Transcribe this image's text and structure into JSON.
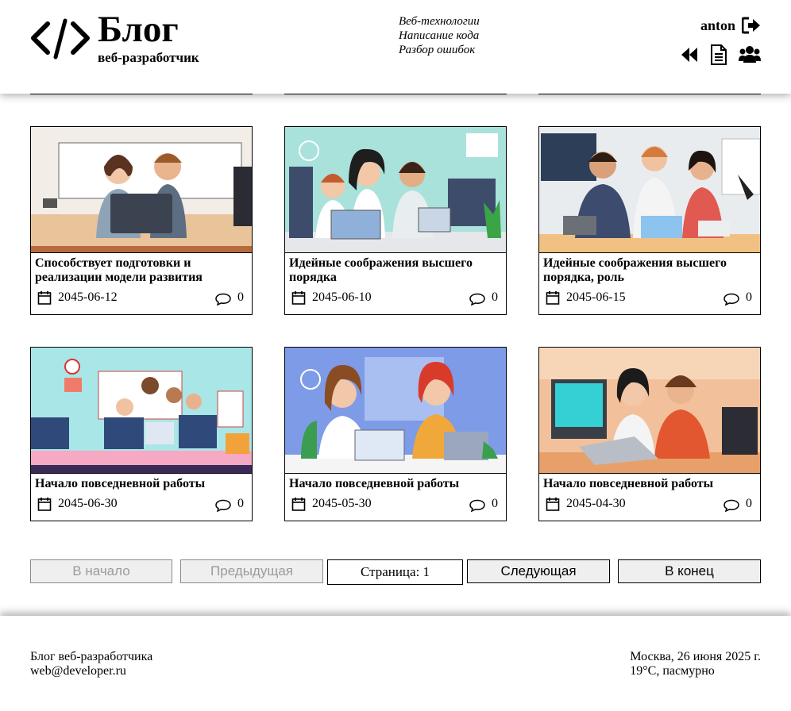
{
  "header": {
    "logo_title": "Блог",
    "logo_subtitle": "веб-разработчик",
    "topics": [
      "Веб-технологии",
      "Написание кода",
      "Разбор ошибок"
    ],
    "username": "anton",
    "icons": [
      "logout-icon",
      "backward-icon",
      "document-icon",
      "users-icon"
    ]
  },
  "posts": [
    {
      "title": "Способствует подготовки и реализации модели развития",
      "date": "2045-06-12",
      "comments": "0"
    },
    {
      "title": "Идейные соображения высшего порядка",
      "date": "2045-06-10",
      "comments": "0"
    },
    {
      "title": "Идейные соображения высшего порядка, роль",
      "date": "2045-06-15",
      "comments": "0"
    },
    {
      "title": "Начало повседневной работы",
      "date": "2045-06-30",
      "comments": "0"
    },
    {
      "title": "Начало повседневной работы",
      "date": "2045-05-30",
      "comments": "0"
    },
    {
      "title": "Начало повседневной работы",
      "date": "2045-04-30",
      "comments": "0"
    }
  ],
  "pagination": {
    "first": "В начало",
    "prev": "Предыдущая",
    "page_info": "Страница: 1",
    "next": "Следующая",
    "last": "В конец"
  },
  "footer": {
    "blog_name": "Блог веб-разработчика",
    "email": "web@developer.ru",
    "date_line": "Москва, 26 июня 2025 г.",
    "weather": "19°C, пасмурно"
  }
}
